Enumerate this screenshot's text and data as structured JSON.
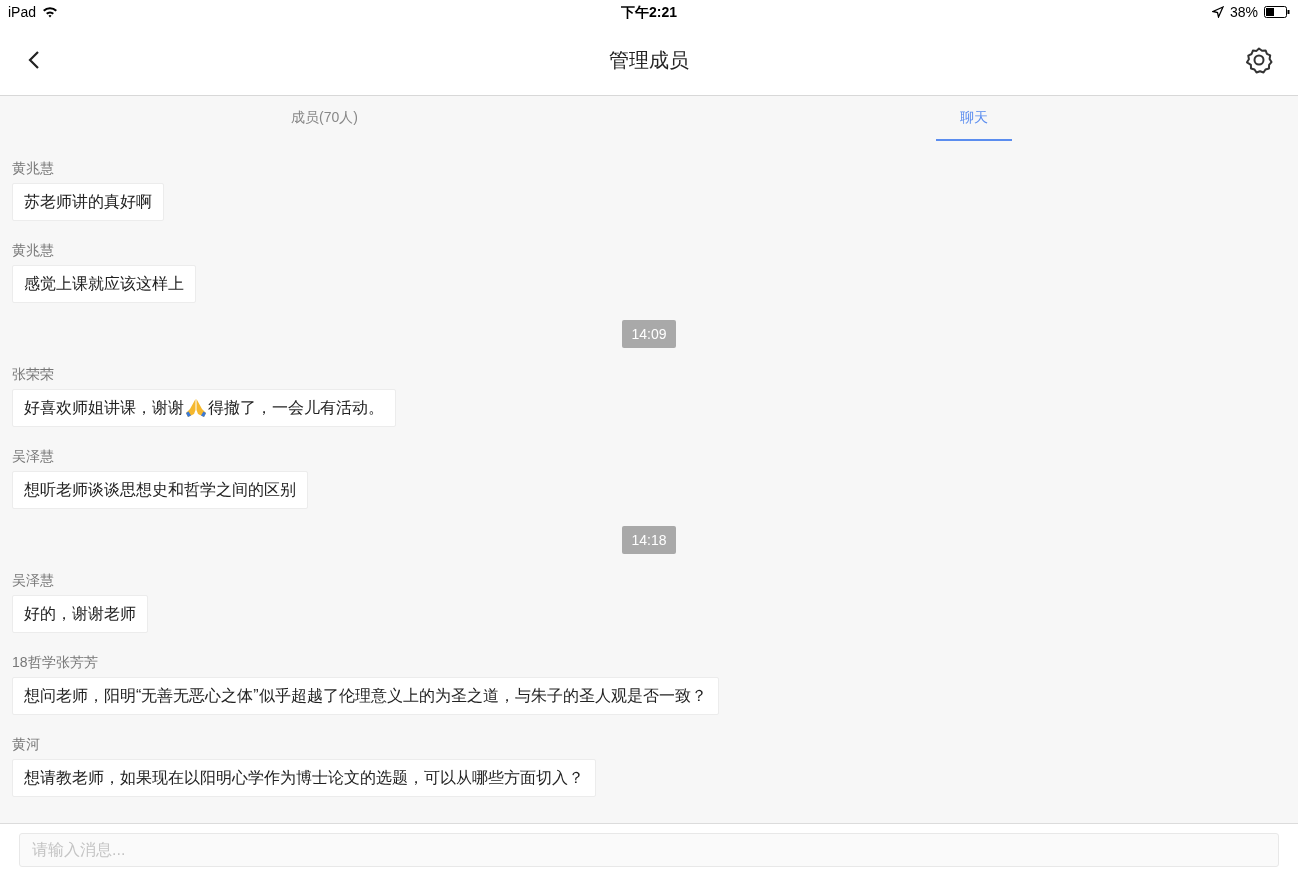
{
  "status_bar": {
    "device": "iPad",
    "time": "下午2:21",
    "battery": "38%"
  },
  "nav": {
    "title": "管理成员"
  },
  "tabs": [
    {
      "label": "成员(70人)",
      "selected": false
    },
    {
      "label": "聊天",
      "selected": true
    }
  ],
  "chat": [
    {
      "kind": "message",
      "sender": "黄兆慧",
      "parts": [
        {
          "kind": "text",
          "text": "苏老师讲的真好啊"
        }
      ]
    },
    {
      "kind": "message",
      "sender": "黄兆慧",
      "parts": [
        {
          "kind": "text",
          "text": "感觉上课就应该这样上"
        }
      ]
    },
    {
      "kind": "time",
      "text": "14:09"
    },
    {
      "kind": "message",
      "sender": "张荣荣",
      "parts": [
        {
          "kind": "text",
          "text": "好喜欢师姐讲课，谢谢"
        },
        {
          "kind": "emoji"
        },
        {
          "kind": "text",
          "text": "得撤了，一会儿有活动。"
        }
      ]
    },
    {
      "kind": "message",
      "sender": "吴泽慧",
      "parts": [
        {
          "kind": "text",
          "text": "想听老师谈谈思想史和哲学之间的区别"
        }
      ]
    },
    {
      "kind": "time",
      "text": "14:18"
    },
    {
      "kind": "message",
      "sender": "吴泽慧",
      "parts": [
        {
          "kind": "text",
          "text": "好的，谢谢老师"
        }
      ]
    },
    {
      "kind": "message",
      "sender": "18哲学张芳芳",
      "parts": [
        {
          "kind": "text",
          "text": "想问老师，阳明“无善无恶心之体”似乎超越了伦理意义上的为圣之道，与朱子的圣人观是否一致？"
        }
      ]
    },
    {
      "kind": "message",
      "sender": "黄河",
      "parts": [
        {
          "kind": "text",
          "text": "想请教老师，如果现在以阳明心学作为博士论文的选题，可以从哪些方面切入？"
        }
      ]
    }
  ],
  "input": {
    "placeholder": "请输入消息..."
  }
}
